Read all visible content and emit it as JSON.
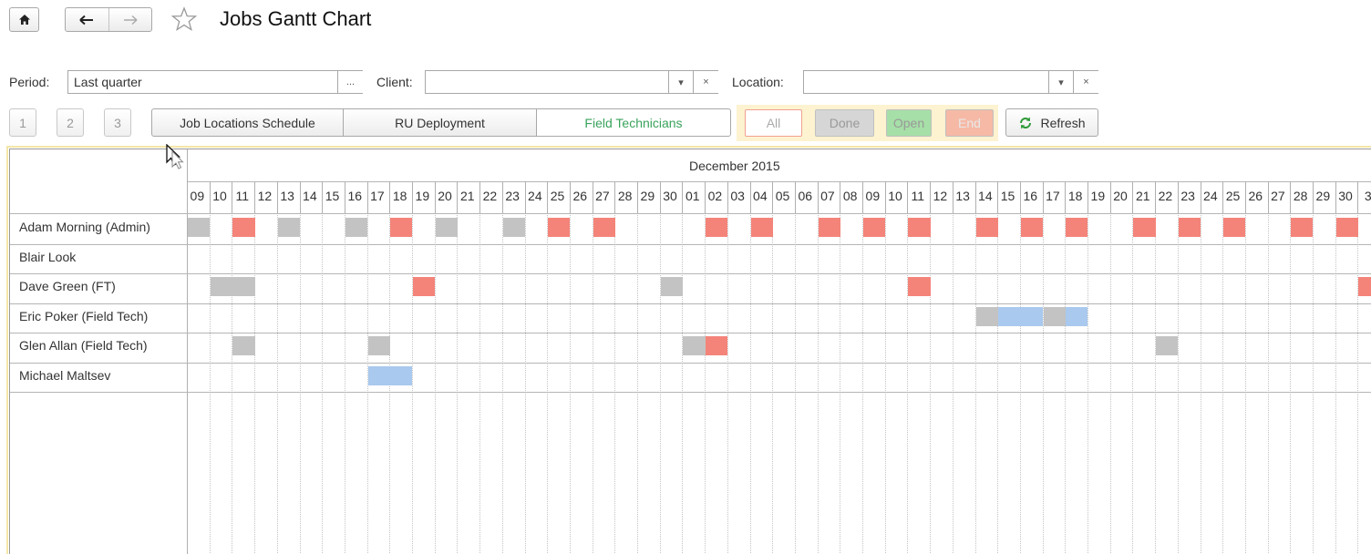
{
  "toolbar": {
    "title": "Jobs Gantt Chart",
    "home_icon": "home-icon",
    "back_icon": "arrow-left-icon",
    "forward_icon": "arrow-right-icon",
    "favorite_icon": "star-outline-icon"
  },
  "filters": {
    "period_label": "Period:",
    "period_value": "Last quarter",
    "period_select_label": "...",
    "client_label": "Client:",
    "client_value": "",
    "location_label": "Location:",
    "location_value": "",
    "dropdown_glyph": "▾",
    "clear_glyph": "×"
  },
  "view_buttons": {
    "pages": [
      "1",
      "2",
      "3"
    ],
    "tabs": [
      "Job Locations Schedule",
      "RU Deployment",
      "Field Technicians"
    ],
    "active_tab": "Field Technicians"
  },
  "status_filters": {
    "all": "All",
    "done": "Done",
    "open": "Open",
    "end": "End",
    "refresh": "Refresh",
    "refresh_icon": "refresh-icon"
  },
  "colors": {
    "gray_job": "#c3c3c3",
    "red_job": "#f4847a",
    "blue_job": "#a9c9ee",
    "active_tab_text": "#3aa35c"
  },
  "gantt": {
    "month_label": "December 2015",
    "days": [
      "09",
      "10",
      "11",
      "12",
      "13",
      "14",
      "15",
      "16",
      "17",
      "18",
      "19",
      "20",
      "21",
      "22",
      "23",
      "24",
      "25",
      "26",
      "27",
      "28",
      "29",
      "30",
      "01",
      "02",
      "03",
      "04",
      "05",
      "06",
      "07",
      "08",
      "09",
      "10",
      "11",
      "12",
      "13",
      "14",
      "15",
      "16",
      "17",
      "18",
      "19",
      "20",
      "21",
      "22",
      "23",
      "24",
      "25",
      "26",
      "27",
      "28",
      "29",
      "30",
      "3"
    ],
    "rows": [
      {
        "name": "Adam Morning (Admin)",
        "bars": [
          {
            "start": 0,
            "len": 1,
            "color": "gray"
          },
          {
            "start": 2,
            "len": 1,
            "color": "red"
          },
          {
            "start": 4,
            "len": 1,
            "color": "gray"
          },
          {
            "start": 7,
            "len": 1,
            "color": "gray"
          },
          {
            "start": 9,
            "len": 1,
            "color": "red"
          },
          {
            "start": 11,
            "len": 1,
            "color": "gray"
          },
          {
            "start": 14,
            "len": 1,
            "color": "gray"
          },
          {
            "start": 16,
            "len": 1,
            "color": "red"
          },
          {
            "start": 18,
            "len": 1,
            "color": "red"
          },
          {
            "start": 23,
            "len": 1,
            "color": "red"
          },
          {
            "start": 25,
            "len": 1,
            "color": "red"
          },
          {
            "start": 28,
            "len": 1,
            "color": "red"
          },
          {
            "start": 30,
            "len": 1,
            "color": "red"
          },
          {
            "start": 32,
            "len": 1,
            "color": "red"
          },
          {
            "start": 35,
            "len": 1,
            "color": "red"
          },
          {
            "start": 37,
            "len": 1,
            "color": "red"
          },
          {
            "start": 39,
            "len": 1,
            "color": "red"
          },
          {
            "start": 42,
            "len": 1,
            "color": "red"
          },
          {
            "start": 44,
            "len": 1,
            "color": "red"
          },
          {
            "start": 46,
            "len": 1,
            "color": "red"
          },
          {
            "start": 49,
            "len": 1,
            "color": "red"
          },
          {
            "start": 51,
            "len": 1,
            "color": "red"
          }
        ]
      },
      {
        "name": "Blair Look",
        "bars": []
      },
      {
        "name": "Dave Green (FT)",
        "bars": [
          {
            "start": 1,
            "len": 2,
            "color": "gray"
          },
          {
            "start": 10,
            "len": 1,
            "color": "red"
          },
          {
            "start": 21,
            "len": 1,
            "color": "gray"
          },
          {
            "start": 32,
            "len": 1,
            "color": "red"
          },
          {
            "start": 52,
            "len": 1,
            "color": "red"
          }
        ]
      },
      {
        "name": "Eric Poker (Field Tech)",
        "bars": [
          {
            "start": 35,
            "len": 1,
            "color": "gray"
          },
          {
            "start": 36,
            "len": 2,
            "color": "blue"
          },
          {
            "start": 38,
            "len": 1,
            "color": "gray"
          },
          {
            "start": 39,
            "len": 1,
            "color": "blue"
          }
        ]
      },
      {
        "name": "Glen Allan (Field Tech)",
        "bars": [
          {
            "start": 2,
            "len": 1,
            "color": "gray"
          },
          {
            "start": 8,
            "len": 1,
            "color": "gray"
          },
          {
            "start": 22,
            "len": 1,
            "color": "gray"
          },
          {
            "start": 23,
            "len": 1,
            "color": "red"
          },
          {
            "start": 43,
            "len": 1,
            "color": "gray"
          }
        ]
      },
      {
        "name": "Michael Maltsev",
        "bars": [
          {
            "start": 8,
            "len": 2,
            "color": "blue"
          }
        ]
      }
    ]
  }
}
